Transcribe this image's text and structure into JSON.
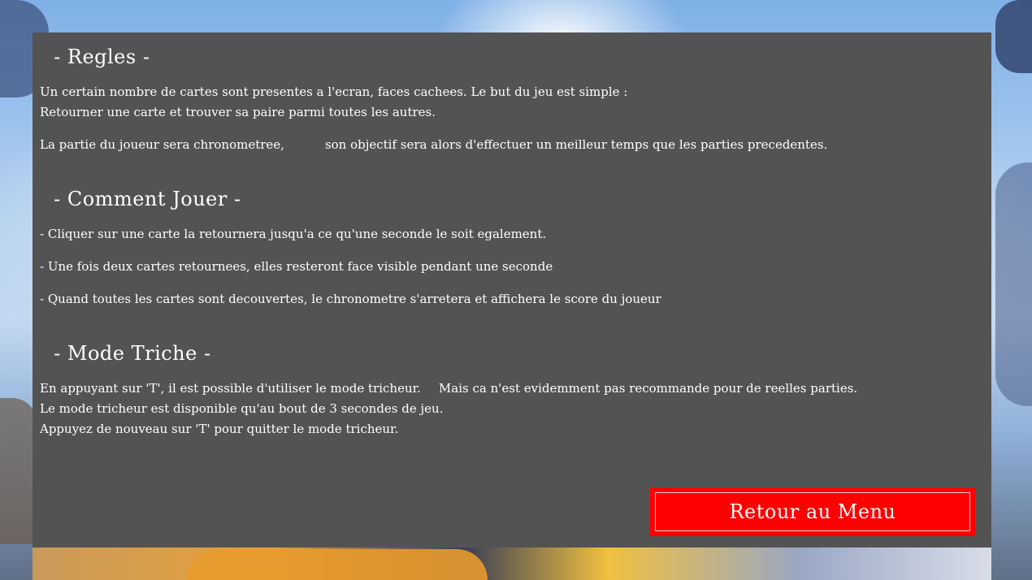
{
  "rules": {
    "title": " - Regles -",
    "line1": "Un certain nombre de cartes sont presentes a l'ecran, faces cachees. Le but du jeu est simple :",
    "line2": "Retourner une carte et trouver sa paire parmi toutes les autres.",
    "line3a": "La partie du joueur sera chronometree,",
    "line3b": "son objectif sera alors d'effectuer un meilleur temps que les parties precedentes."
  },
  "howto": {
    "title": " - Comment Jouer -",
    "item1": "- Cliquer sur une carte la retournera jusqu'a ce qu'une seconde le soit egalement.",
    "item2": "- Une fois deux cartes retournees, elles resteront face visible pendant une seconde",
    "item3": "- Quand toutes les cartes sont decouvertes, le chronometre s'arretera et affichera le score du joueur"
  },
  "cheat": {
    "title": " - Mode Triche -",
    "line1a": "En appuyant sur 'T', il est possible d'utiliser le mode tricheur.",
    "line1b": "Mais ca n'est evidemment pas recommande pour de reelles parties.",
    "line2": "Le mode tricheur est disponible qu'au bout de 3 secondes de jeu.",
    "line3": "Appuyez de nouveau sur 'T' pour quitter le mode tricheur."
  },
  "back_button": {
    "label": "Retour au Menu"
  },
  "colors": {
    "panel": "#535353",
    "button": "#ff0000",
    "text": "#ffffff"
  }
}
